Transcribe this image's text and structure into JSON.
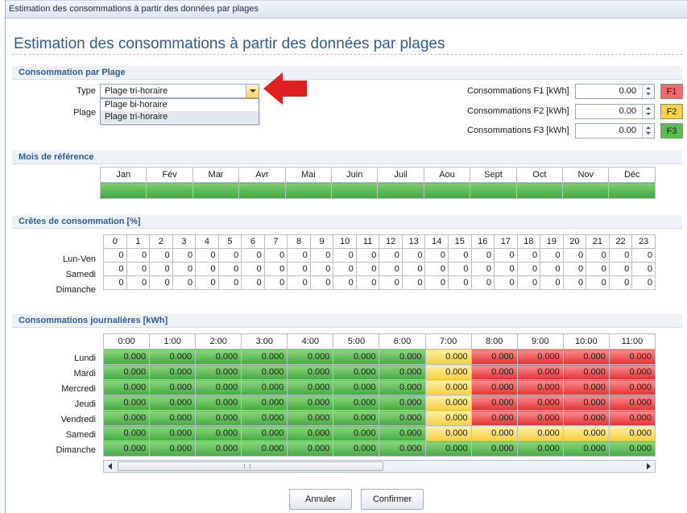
{
  "window": {
    "titlebar": "Estimation des consommations à partir des données par plages",
    "title": "Estimation des consommations à partir des données par plages"
  },
  "consommation_par_plage": {
    "header": "Consommation par Plage",
    "type_label": "Type",
    "plage_label": "Plage",
    "type_value": "Plage tri-horaire",
    "dropdown_options": [
      "Plage bi-horaire",
      "Plage tri-horaire"
    ],
    "dropdown_selected": "Plage tri-horaire",
    "fields": [
      {
        "label": "Consommations F1 [kWh]",
        "value": "0.00",
        "badge": "F1",
        "badge_color": "#f26a6a"
      },
      {
        "label": "Consommations F2 [kWh]",
        "value": "0.00",
        "badge": "F2",
        "badge_color": "#f6d24b"
      },
      {
        "label": "Consommations F3 [kWh]",
        "value": "0.00",
        "badge": "F3",
        "badge_color": "#5dbb55"
      }
    ]
  },
  "mois_reference": {
    "header": "Mois de référence",
    "months": [
      "Jan",
      "Fév",
      "Mar",
      "Avr",
      "Mai",
      "Juin",
      "Juil",
      "Aou",
      "Sept",
      "Oct",
      "Nov",
      "Déc"
    ]
  },
  "cretes": {
    "header": "Crêtes de consommation [%]",
    "hours": [
      "0",
      "1",
      "2",
      "3",
      "4",
      "5",
      "6",
      "7",
      "8",
      "9",
      "10",
      "11",
      "12",
      "13",
      "14",
      "15",
      "16",
      "17",
      "18",
      "19",
      "20",
      "21",
      "22",
      "23"
    ],
    "rows": [
      {
        "label": "Lun-Ven",
        "values": [
          "0",
          "0",
          "0",
          "0",
          "0",
          "0",
          "0",
          "0",
          "0",
          "0",
          "0",
          "0",
          "0",
          "0",
          "0",
          "0",
          "0",
          "0",
          "0",
          "0",
          "0",
          "0",
          "0",
          "0"
        ]
      },
      {
        "label": "Samedi",
        "values": [
          "0",
          "0",
          "0",
          "0",
          "0",
          "0",
          "0",
          "0",
          "0",
          "0",
          "0",
          "0",
          "0",
          "0",
          "0",
          "0",
          "0",
          "0",
          "0",
          "0",
          "0",
          "0",
          "0",
          "0"
        ]
      },
      {
        "label": "Dimanche",
        "values": [
          "0",
          "0",
          "0",
          "0",
          "0",
          "0",
          "0",
          "0",
          "0",
          "0",
          "0",
          "0",
          "0",
          "0",
          "0",
          "0",
          "0",
          "0",
          "0",
          "0",
          "0",
          "0",
          "0",
          "0"
        ]
      }
    ]
  },
  "journalieres": {
    "header": "Consommations journalières [kWh]",
    "hours": [
      "0:00",
      "1:00",
      "2:00",
      "3:00",
      "4:00",
      "5:00",
      "6:00",
      "7:00",
      "8:00",
      "9:00",
      "10:00",
      "11:00"
    ],
    "colors": {
      "g": "#4caf44",
      "y": "#f6d24b",
      "r": "#ea3b3b"
    },
    "rows": [
      {
        "label": "Lundi",
        "values": [
          "0.000",
          "0.000",
          "0.000",
          "0.000",
          "0.000",
          "0.000",
          "0.000",
          "0.000",
          "0.000",
          "0.000",
          "0.000",
          "0.000"
        ],
        "bands": [
          "g",
          "g",
          "g",
          "g",
          "g",
          "g",
          "g",
          "y",
          "r",
          "r",
          "r",
          "r"
        ]
      },
      {
        "label": "Mardi",
        "values": [
          "0.000",
          "0.000",
          "0.000",
          "0.000",
          "0.000",
          "0.000",
          "0.000",
          "0.000",
          "0.000",
          "0.000",
          "0.000",
          "0.000"
        ],
        "bands": [
          "g",
          "g",
          "g",
          "g",
          "g",
          "g",
          "g",
          "y",
          "r",
          "r",
          "r",
          "r"
        ]
      },
      {
        "label": "Mercredi",
        "values": [
          "0.000",
          "0.000",
          "0.000",
          "0.000",
          "0.000",
          "0.000",
          "0.000",
          "0.000",
          "0.000",
          "0.000",
          "0.000",
          "0.000"
        ],
        "bands": [
          "g",
          "g",
          "g",
          "g",
          "g",
          "g",
          "g",
          "y",
          "r",
          "r",
          "r",
          "r"
        ]
      },
      {
        "label": "Jeudi",
        "values": [
          "0.000",
          "0.000",
          "0.000",
          "0.000",
          "0.000",
          "0.000",
          "0.000",
          "0.000",
          "0.000",
          "0.000",
          "0.000",
          "0.000"
        ],
        "bands": [
          "g",
          "g",
          "g",
          "g",
          "g",
          "g",
          "g",
          "y",
          "r",
          "r",
          "r",
          "r"
        ]
      },
      {
        "label": "Vendredi",
        "values": [
          "0.000",
          "0.000",
          "0.000",
          "0.000",
          "0.000",
          "0.000",
          "0.000",
          "0.000",
          "0.000",
          "0.000",
          "0.000",
          "0.000"
        ],
        "bands": [
          "g",
          "g",
          "g",
          "g",
          "g",
          "g",
          "g",
          "y",
          "r",
          "r",
          "r",
          "r"
        ]
      },
      {
        "label": "Samedi",
        "values": [
          "0.000",
          "0.000",
          "0.000",
          "0.000",
          "0.000",
          "0.000",
          "0.000",
          "0.000",
          "0.000",
          "0.000",
          "0.000",
          "0.000"
        ],
        "bands": [
          "g",
          "g",
          "g",
          "g",
          "g",
          "g",
          "g",
          "y",
          "y",
          "y",
          "y",
          "y"
        ]
      },
      {
        "label": "Dimanche",
        "values": [
          "0.000",
          "0.000",
          "0.000",
          "0.000",
          "0.000",
          "0.000",
          "0.000",
          "0.000",
          "0.000",
          "0.000",
          "0.000",
          "0.000"
        ],
        "bands": [
          "g",
          "g",
          "g",
          "g",
          "g",
          "g",
          "g",
          "g",
          "g",
          "g",
          "g",
          "g"
        ]
      }
    ]
  },
  "buttons": {
    "cancel": "Annuler",
    "confirm": "Confirmer"
  },
  "annotation": {
    "arrow_color": "#e02020",
    "arrow_icon": "red-arrow-pointer-icon"
  }
}
